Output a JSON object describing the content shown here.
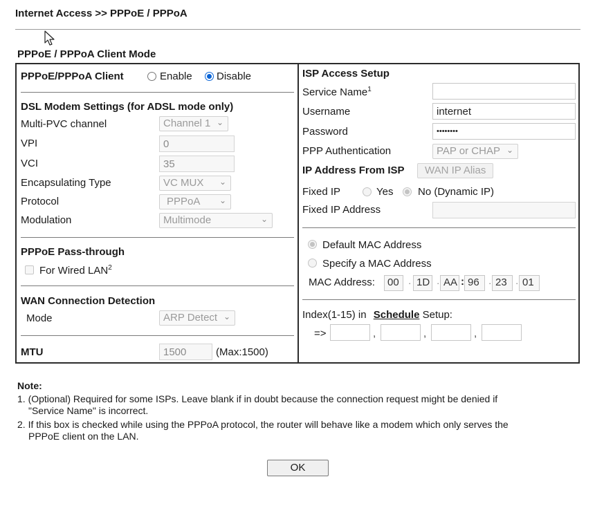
{
  "breadcrumb": "Internet Access >> PPPoE / PPPoA",
  "section_title": "PPPoE / PPPoA Client Mode",
  "left": {
    "client": {
      "label": "PPPoE/PPPoA Client",
      "enable_label": "Enable",
      "disable_label": "Disable",
      "selected": "Disable"
    },
    "dsl": {
      "title": "DSL Modem Settings (for ADSL mode only)",
      "multi_pvc_label": "Multi-PVC channel",
      "multi_pvc_value": "Channel 1",
      "vpi_label": "VPI",
      "vpi_value": "0",
      "vci_label": "VCI",
      "vci_value": "35",
      "encap_label": "Encapsulating Type",
      "encap_value": "VC MUX",
      "protocol_label": "Protocol",
      "protocol_value": "PPPoA",
      "modulation_label": "Modulation",
      "modulation_value": "Multimode"
    },
    "passthrough": {
      "title": "PPPoE Pass-through",
      "wired_lan_label": "For Wired LAN",
      "wired_lan_sup": "2",
      "checked": false
    },
    "wan_detect": {
      "title": "WAN Connection Detection",
      "mode_label": "Mode",
      "mode_value": "ARP Detect"
    },
    "mtu": {
      "label": "MTU",
      "value": "1500",
      "hint": "(Max:1500)"
    }
  },
  "right": {
    "isp": {
      "title": "ISP Access Setup",
      "service_name_label": "Service Name",
      "service_name_sup": "1",
      "service_name_value": "",
      "username_label": "Username",
      "username_value": "internet",
      "password_label": "Password",
      "password_value": "••••••••",
      "auth_label": "PPP Authentication",
      "auth_value": "PAP or CHAP"
    },
    "ip": {
      "title": "IP Address From ISP",
      "wan_alias_button": "WAN IP Alias",
      "fixed_ip_label": "Fixed IP",
      "yes_label": "Yes",
      "no_label": "No (Dynamic IP)",
      "selected": "No (Dynamic IP)",
      "fixed_ip_address_label": "Fixed IP Address",
      "fixed_ip_address_value": ""
    },
    "mac": {
      "default_label": "Default MAC Address",
      "specify_label": "Specify a MAC Address",
      "selected": "Default MAC Address",
      "address_label": "MAC Address:",
      "octets": [
        "00",
        "1D",
        "AA",
        "96",
        "23",
        "01"
      ]
    },
    "schedule": {
      "prefix": "Index(1-15) in",
      "link": "Schedule",
      "suffix": "Setup:",
      "arrow": "=>",
      "values": [
        "",
        "",
        "",
        ""
      ]
    }
  },
  "note": {
    "title": "Note:",
    "items": [
      "1. (Optional) Required for some ISPs. Leave blank if in doubt because the connection request might be denied if",
      "\"Service Name\" is incorrect.",
      "2. If this box is checked while using the PPPoA protocol, the router will behave like a modem which only serves the",
      "PPPoE client on the LAN."
    ]
  },
  "ok_button": "OK"
}
